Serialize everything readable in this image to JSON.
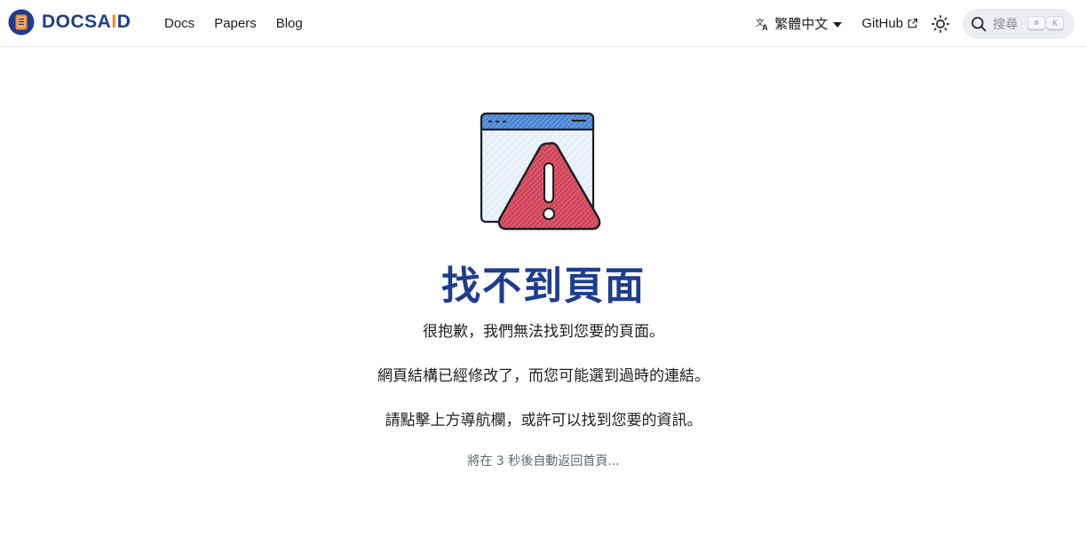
{
  "navbar": {
    "brand": {
      "text_main": "DOCSA",
      "text_accent": "I",
      "text_end": "D"
    },
    "links": [
      {
        "label": "Docs"
      },
      {
        "label": "Papers"
      },
      {
        "label": "Blog"
      }
    ],
    "language": {
      "label": "繁體中文",
      "icon": "translate-icon"
    },
    "github": {
      "label": "GitHub",
      "icon": "external-link-icon"
    },
    "theme_toggle": {
      "icon": "sun-icon"
    },
    "search": {
      "placeholder": "搜尋",
      "keys": [
        "⌘",
        "K"
      ],
      "icon": "search-icon"
    }
  },
  "main": {
    "illustration": {
      "icon": "browser-warning-icon"
    },
    "title": "找不到頁面",
    "messages": [
      "很抱歉，我們無法找到您要的頁面。",
      "網頁結構已經修改了，而您可能選到過時的連結。",
      "請點擊上方導航欄，或許可以找到您要的資訊。"
    ],
    "redirect_note": "將在 3 秒後自動返回首頁..."
  },
  "colors": {
    "brand_blue": "#1d3d8f",
    "brand_orange": "#f28c28",
    "warning_red": "#d0455b",
    "window_blue": "#4a86d4"
  }
}
